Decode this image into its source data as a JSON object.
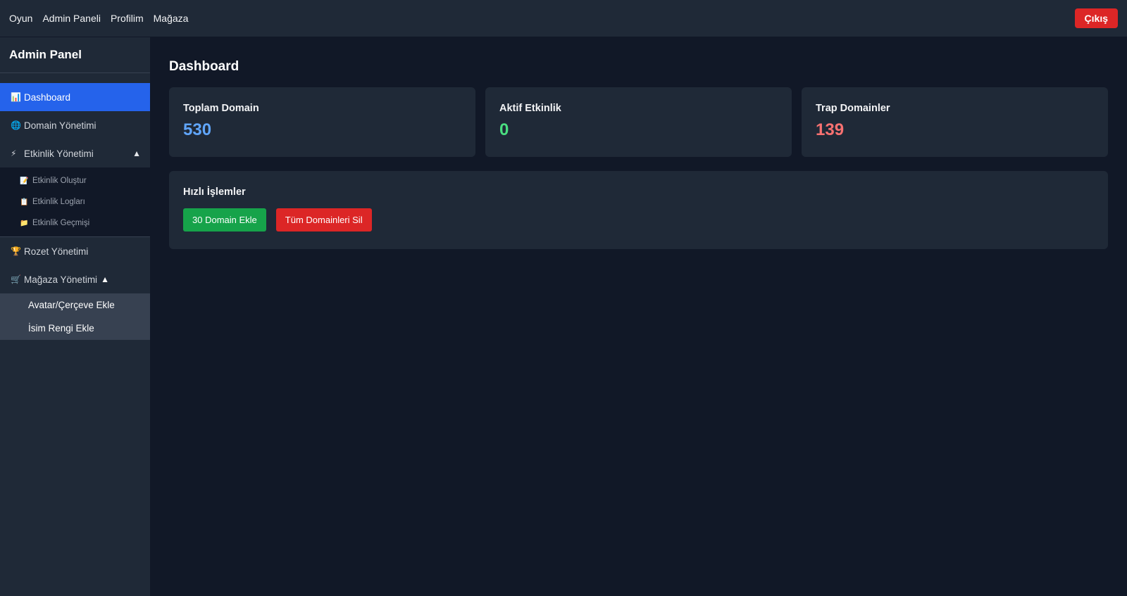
{
  "topnav": {
    "links": [
      "Oyun",
      "Admin Paneli",
      "Profilim",
      "Mağaza"
    ],
    "logout_label": "Çıkış"
  },
  "sidebar": {
    "title": "Admin Panel",
    "items": [
      {
        "icon": "📊",
        "icon_name": "bar-chart-icon",
        "label": "Dashboard"
      },
      {
        "icon": "🌐",
        "icon_name": "globe-icon",
        "label": "Domain Yönetimi"
      },
      {
        "icon": "⚡",
        "icon_name": "lightning-icon",
        "label": "Etkinlik Yönetimi",
        "caret": "▲"
      },
      {
        "icon": "🏆",
        "icon_name": "trophy-icon",
        "label": "Rozet Yönetimi"
      },
      {
        "icon": "🛒",
        "icon_name": "cart-icon",
        "label": "Mağaza Yönetimi",
        "caret": "▲"
      }
    ],
    "event_subitems": [
      {
        "icon": "📝",
        "icon_name": "memo-icon",
        "label": "Etkinlik Oluştur"
      },
      {
        "icon": "📋",
        "icon_name": "clipboard-icon",
        "label": "Etkinlik Logları"
      },
      {
        "icon": "📁",
        "icon_name": "folder-icon",
        "label": "Etkinlik Geçmişi"
      }
    ],
    "store_subitems": [
      "Avatar/Çerçeve Ekle",
      "İsim Rengi Ekle"
    ]
  },
  "main": {
    "title": "Dashboard",
    "stats": [
      {
        "label": "Toplam Domain",
        "value": "530",
        "color": "#60a5fa"
      },
      {
        "label": "Aktif Etkinlik",
        "value": "0",
        "color": "#4ade80"
      },
      {
        "label": "Trap Domainler",
        "value": "139",
        "color": "#f87171"
      }
    ],
    "quick": {
      "title": "Hızlı İşlemler",
      "add_button": "30 Domain Ekle",
      "delete_button": "Tüm Domainleri Sil",
      "add_color": "#16a34a",
      "delete_color": "#dc2626"
    }
  }
}
